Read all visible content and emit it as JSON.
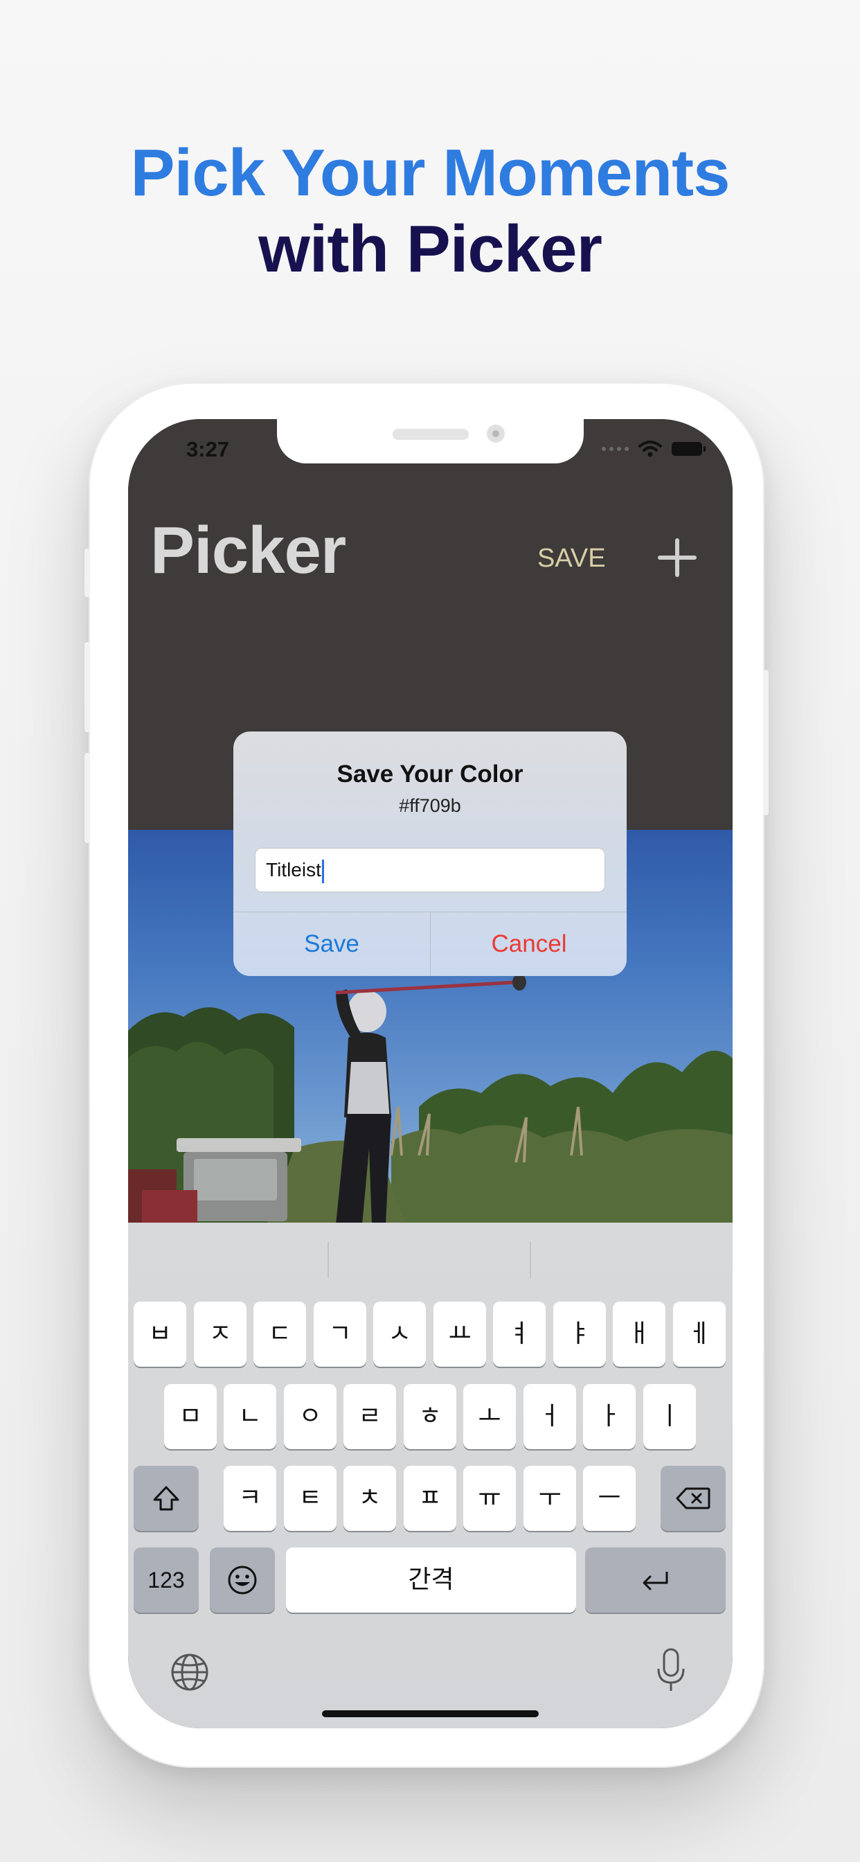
{
  "headline": {
    "line1": "Pick Your Moments",
    "line2": "with Picker"
  },
  "colors": {
    "accent": "#2f7ce0",
    "dark_title": "#17124f",
    "topbar_bg": "#3e3b3a",
    "save_top": "#d9cfa6",
    "dialog_save": "#1b7ad8",
    "dialog_cancel": "#ec3a33"
  },
  "status_bar": {
    "time": "3:27"
  },
  "nav": {
    "title": "Picker",
    "save_label": "SAVE",
    "add_icon": "plus-icon"
  },
  "dialog": {
    "title": "Save Your Color",
    "subtitle": "#ff709b",
    "input_value": "Titleist",
    "save_label": "Save",
    "cancel_label": "Cancel"
  },
  "keyboard": {
    "row1": [
      "ㅂ",
      "ㅈ",
      "ㄷ",
      "ㄱ",
      "ㅅ",
      "ㅛ",
      "ㅕ",
      "ㅑ",
      "ㅐ",
      "ㅔ"
    ],
    "row2": [
      "ㅁ",
      "ㄴ",
      "ㅇ",
      "ㄹ",
      "ㅎ",
      "ㅗ",
      "ㅓ",
      "ㅏ",
      "ㅣ"
    ],
    "row3": [
      "ㅋ",
      "ㅌ",
      "ㅊ",
      "ㅍ",
      "ㅠ",
      "ㅜ",
      "ㅡ"
    ],
    "numbers_label": "123",
    "space_label": "간격",
    "icons": {
      "shift": "shift-icon",
      "delete": "delete-icon",
      "emoji": "emoji-icon",
      "return": "return-icon",
      "globe": "globe-icon",
      "mic": "microphone-icon"
    }
  }
}
